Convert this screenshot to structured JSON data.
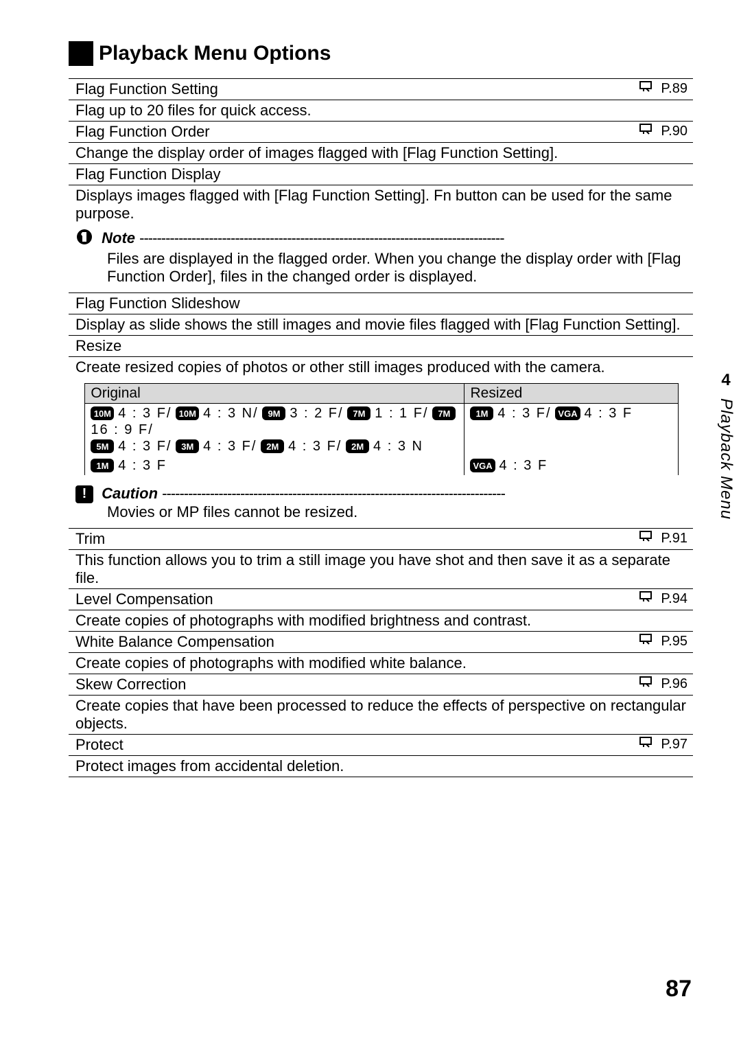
{
  "title": "Playback Menu Options",
  "side": {
    "chapter": "4",
    "label": "Playback Menu"
  },
  "pageNumber": "87",
  "items": [
    {
      "title": "Flag Function Setting",
      "page": "P.89",
      "desc": "Flag up to 20 files for quick access."
    },
    {
      "title": "Flag Function Order",
      "page": "P.90",
      "desc": "Change the display order of images flagged with [Flag Function Setting]."
    },
    {
      "title": "Flag Function Display",
      "page": "",
      "desc": "Displays images flagged with [Flag Function Setting]. Fn button can be used for the same purpose."
    },
    {
      "title": "Flag Function Slideshow",
      "page": "",
      "desc": "Display as slide shows the still images and movie files flagged with [Flag Function Setting]."
    },
    {
      "title": "Resize",
      "page": "",
      "desc": "Create resized copies of photos or other still images produced with the camera."
    },
    {
      "title": "Trim",
      "page": "P.91",
      "desc": "This function allows you to trim a still image you have shot and then save it as a separate file."
    },
    {
      "title": "Level Compensation",
      "page": "P.94",
      "desc": "Create copies of photographs with modified brightness and contrast."
    },
    {
      "title": "White Balance Compensation",
      "page": "P.95",
      "desc": "Create copies of photographs with modified white balance."
    },
    {
      "title": "Skew Correction",
      "page": "P.96",
      "desc": "Create copies that have been processed to reduce the effects of perspective on rectangular objects."
    },
    {
      "title": "Protect",
      "page": "P.97",
      "desc": "Protect images from accidental deletion."
    }
  ],
  "note": {
    "label": "Note",
    "body": "Files are displayed in the flagged order. When you change the display order with [Flag Function Order], files in the changed order is displayed."
  },
  "caution": {
    "label": "Caution",
    "body": "Movies or MP files cannot be resized."
  },
  "resizeTable": {
    "headers": [
      "Original",
      "Resized"
    ],
    "rows": [
      {
        "orig": [
          {
            "b": "10M",
            "r": "4 : 3 F/"
          },
          {
            "b": "10M",
            "r": "4 : 3 N/"
          },
          {
            "b": "9M",
            "r": "3 : 2 F/"
          },
          {
            "b": "7M",
            "r": "1 : 1 F/"
          },
          {
            "b": "7M",
            "r": "16 : 9 F/"
          },
          {
            "b": "5M",
            "r": "4 : 3 F/"
          },
          {
            "b": "3M",
            "r": "4 : 3 F/"
          },
          {
            "b": "2M",
            "r": "4 : 3 F/"
          },
          {
            "b": "2M",
            "r": "4 : 3 N"
          }
        ],
        "res": [
          {
            "b": "1M",
            "r": "4 : 3 F/"
          },
          {
            "b": "VGA",
            "r": "4 : 3 F"
          }
        ]
      },
      {
        "orig": [
          {
            "b": "1M",
            "r": "4 : 3 F"
          }
        ],
        "res": [
          {
            "b": "VGA",
            "r": "4 : 3 F"
          }
        ]
      }
    ]
  }
}
